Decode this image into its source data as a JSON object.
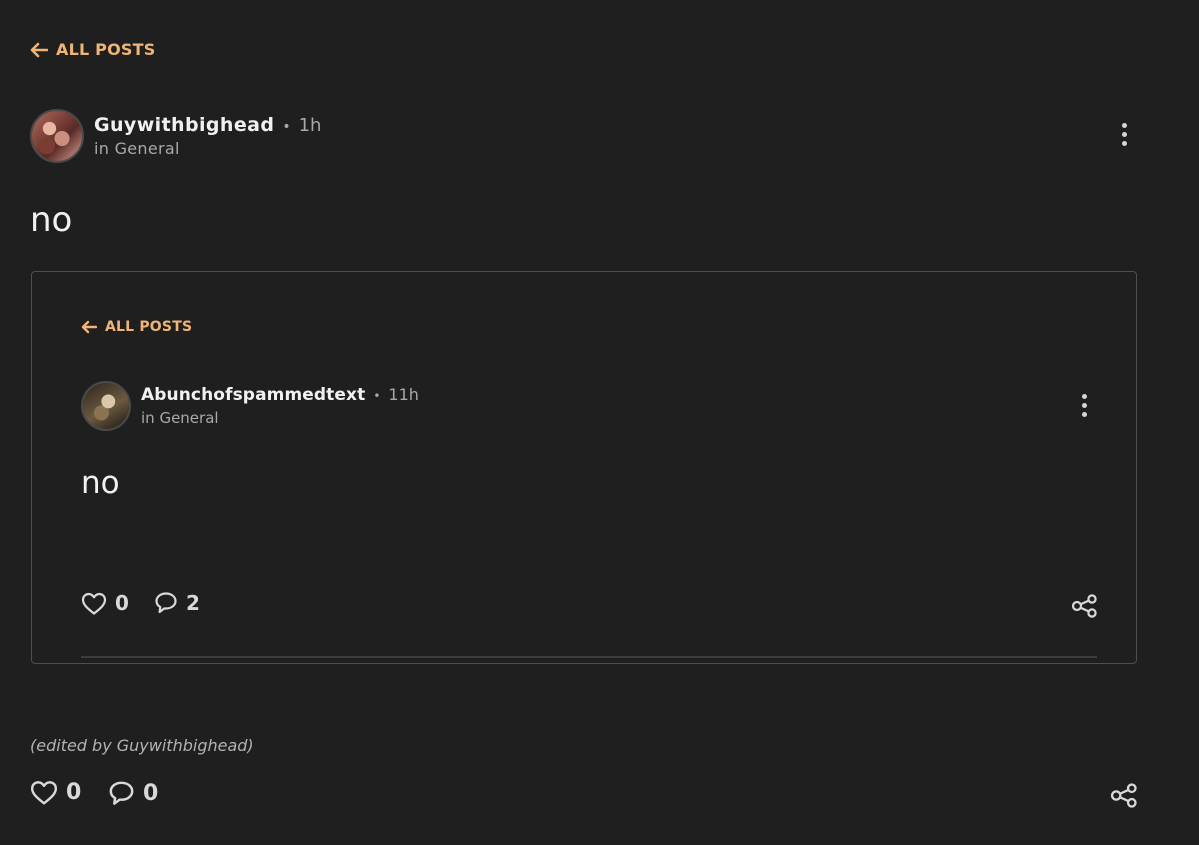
{
  "back_link": {
    "label": "ALL POSTS"
  },
  "post": {
    "author": "Guywithbighead",
    "separator": "•",
    "time": "1h",
    "category": "in General",
    "body": "no",
    "edited_note": "(edited by Guywithbighead)",
    "likes": "0",
    "comments": "0"
  },
  "embedded_post": {
    "back_link_label": "ALL POSTS",
    "author": "Abunchofspammedtext",
    "separator": "•",
    "time": "11h",
    "category": "in General",
    "body": "no",
    "likes": "0",
    "comments": "2"
  },
  "colors": {
    "background": "#1f1f20",
    "accent": "#f0b474",
    "text": "#f1f1f1",
    "muted": "#a9a9a9"
  },
  "icons": {
    "back": "arrow-left-icon",
    "menu": "kebab-menu-icon",
    "like": "heart-icon",
    "comment": "speech-bubble-icon",
    "share": "share-icon"
  }
}
